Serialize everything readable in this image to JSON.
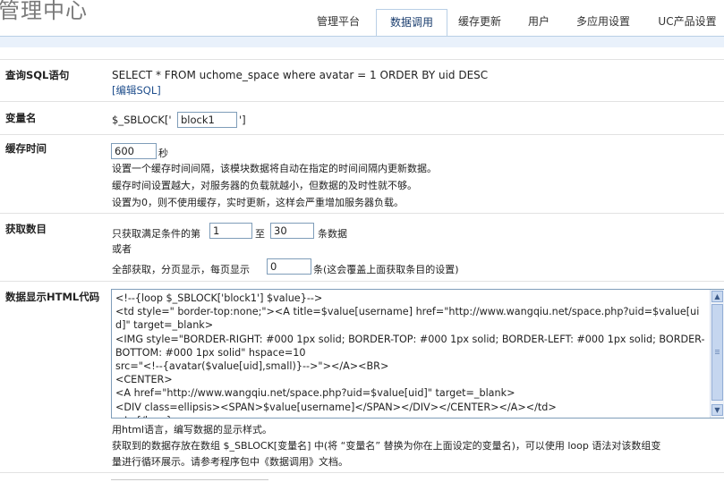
{
  "header": {
    "app_title": "管理中心",
    "tabs": [
      {
        "label": "管理平台",
        "active": false
      },
      {
        "label": "数据调用",
        "active": true
      },
      {
        "label": "缓存更新",
        "active": false
      },
      {
        "label": "用户",
        "active": false
      },
      {
        "label": "多应用设置",
        "active": false
      },
      {
        "label": "UC产品设置",
        "active": false
      }
    ]
  },
  "form": {
    "sql": {
      "label": "查询SQL语句",
      "query": "SELECT * FROM uchome_space where avatar = 1 ORDER BY uid DESC",
      "edit_link": "[编辑SQL]"
    },
    "varname": {
      "label": "变量名",
      "prefix": "$_SBLOCK['",
      "value": "block1",
      "suffix": "']"
    },
    "cache": {
      "label": "缓存时间",
      "value": "600",
      "unit": "秒",
      "help1": "设置一个缓存时间间隔，该模块数据将自动在指定的时间间隔内更新数据。",
      "help2": "缓存时间设置越大，对服务器的负载就越小，但数据的及时性就不够。",
      "help3": "设置为0，则不使用缓存，实时更新，这样会严重增加服务器负载。"
    },
    "count": {
      "label": "获取数目",
      "text_before": "只获取满足条件的第",
      "start": "1",
      "to": "至",
      "end": "30",
      "text_after": "条数据",
      "or": "或者",
      "paging_before": "全部获取，分页显示，每页显示",
      "per_page": "0",
      "paging_after": "条(这会覆盖上面获取条目的设置)"
    },
    "html": {
      "label": "数据显示HTML代码",
      "code": "<!--{loop $_SBLOCK['block1'] $value}-->\n<td style=\" border-top:none;\"><A title=$value[username] href=\"http://www.wangqiu.net/space.php?uid=$value[uid]\" target=_blank>\n<IMG style=\"BORDER-RIGHT: #000 1px solid; BORDER-TOP: #000 1px solid; BORDER-LEFT: #000 1px solid; BORDER-BOTTOM: #000 1px solid\" hspace=10\nsrc=\"<!--{avatar($value[uid],small)}-->\"></A><BR>\n<CENTER>\n<A href=\"http://www.wangqiu.net/space.php?uid=$value[uid]\" target=_blank>\n<DIV class=ellipsis><SPAN>$value[username]</SPAN></DIV></CENTER></A></td>\n<!--{/loop}-->",
      "help1": "用html语言，编写数据的显示样式。",
      "help2": "获取到的数据存放在数组 $_SBLOCK[变量名] 中(将 “变量名” 替换为你在上面设定的变量名)，可以使用 loop 语法对该数组变",
      "help3": "量进行循环展示。请参考程序包中《数据调用》文档。"
    }
  },
  "colors": {
    "tab_border": "#b9cfe6",
    "header_band": "#e9f1fb",
    "link": "#1f4e8c",
    "input_border": "#7f9db9"
  }
}
